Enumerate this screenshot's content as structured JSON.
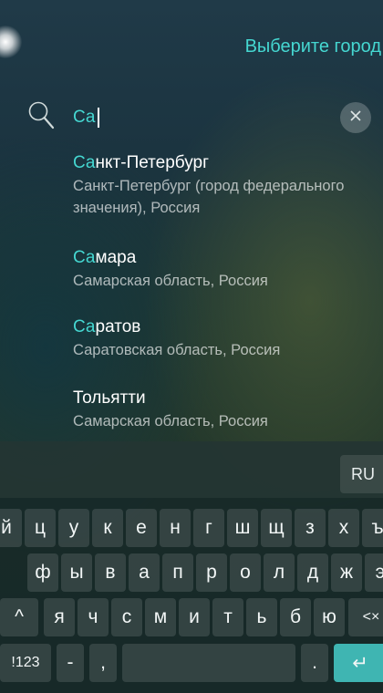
{
  "header": {
    "title": "Выберите город"
  },
  "search": {
    "value": "Са"
  },
  "results": [
    {
      "highlight": "Са",
      "rest": "нкт-Петербург",
      "subtitle": "Санкт-Петербург (город федерального значения), Россия"
    },
    {
      "highlight": "Са",
      "rest": "мара",
      "subtitle": "Самарская область, Россия"
    },
    {
      "highlight": "Са",
      "rest": "ратов",
      "subtitle": "Саратовская область, Россия"
    },
    {
      "highlight": "",
      "rest": "Тольятти",
      "subtitle": "Самарская область, Россия"
    }
  ],
  "keyboard": {
    "language_label": "RU",
    "row1": [
      "й",
      "ц",
      "у",
      "к",
      "е",
      "н",
      "г",
      "ш",
      "щ",
      "з",
      "х",
      "ъ"
    ],
    "row2": [
      "ф",
      "ы",
      "в",
      "а",
      "п",
      "р",
      "о",
      "л",
      "д",
      "ж",
      "э"
    ],
    "row3": [
      "я",
      "ч",
      "с",
      "м",
      "и",
      "т",
      "ь",
      "б",
      "ю"
    ],
    "shift_icon": "^",
    "backspace_icon": "<×",
    "symbols_label": "!123",
    "dash_label": "-",
    "comma_label": ",",
    "period_label": ".",
    "enter_icon": "↵"
  },
  "colors": {
    "accent": "#45d7d1",
    "enter_key": "#3fb5b2"
  }
}
